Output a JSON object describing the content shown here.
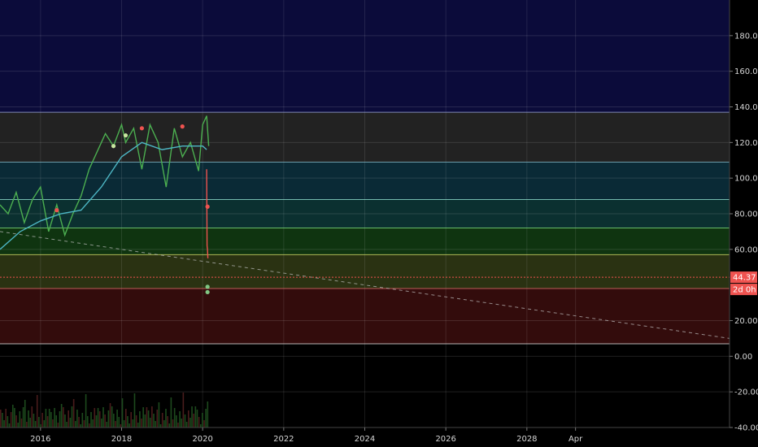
{
  "chart_data": {
    "type": "line",
    "xlim": [
      2015.0,
      2033.0
    ],
    "ylim": [
      -40,
      200
    ],
    "y_ticks": [
      {
        "value": 180,
        "label": "180.00"
      },
      {
        "value": 160,
        "label": "160.00"
      },
      {
        "value": 140,
        "label": "140.00"
      },
      {
        "value": 120,
        "label": "120.00"
      },
      {
        "value": 100,
        "label": "100.00"
      },
      {
        "value": 80,
        "label": "80.00"
      },
      {
        "value": 60,
        "label": "60.00"
      },
      {
        "value": 20,
        "label": "20.00"
      },
      {
        "value": 0,
        "label": "0.00"
      },
      {
        "value": -20,
        "label": "-20.00"
      },
      {
        "value": -40,
        "label": "-40.00"
      }
    ],
    "x_ticks": [
      {
        "value": 2016,
        "label": "2016"
      },
      {
        "value": 2018,
        "label": "2018"
      },
      {
        "value": 2020,
        "label": "2020"
      },
      {
        "value": 2022,
        "label": "2022"
      },
      {
        "value": 2024,
        "label": "2024"
      },
      {
        "value": 2026,
        "label": "2026"
      },
      {
        "value": 2028,
        "label": "2028"
      },
      {
        "value": 2029.2,
        "label": "Apr"
      }
    ],
    "bands": [
      {
        "from": 137,
        "to": 200,
        "color": "#0b0b3a"
      },
      {
        "from": 109,
        "to": 137,
        "color": "#222222"
      },
      {
        "from": 88,
        "to": 109,
        "color": "#0a2a36"
      },
      {
        "from": 72,
        "to": 88,
        "color": "#0b3030"
      },
      {
        "from": 57,
        "to": 72,
        "color": "#0f3410"
      },
      {
        "from": 38,
        "to": 57,
        "color": "#2a3212"
      },
      {
        "from": 7,
        "to": 38,
        "color": "#330c0c"
      }
    ],
    "band_lines": [
      {
        "value": 137,
        "color": "#9aa6d8"
      },
      {
        "value": 109,
        "color": "#7fb8c8"
      },
      {
        "value": 88,
        "color": "#8fe0d0"
      },
      {
        "value": 72,
        "color": "#7ee07a"
      },
      {
        "value": 57,
        "color": "#d4dc6a"
      },
      {
        "value": 38,
        "color": "#e06a6a"
      },
      {
        "value": 7,
        "color": "#e0e0e0"
      }
    ],
    "series": [
      {
        "color": "#4caf50",
        "x": [
          2015.0,
          2015.2,
          2015.4,
          2015.6,
          2015.8,
          2016.0,
          2016.2,
          2016.4,
          2016.6,
          2016.8,
          2017.0,
          2017.2,
          2017.4,
          2017.6,
          2017.8,
          2018.0,
          2018.1,
          2018.3,
          2018.5,
          2018.7,
          2018.9,
          2019.1,
          2019.3,
          2019.5,
          2019.7,
          2019.9,
          2020.0,
          2020.1,
          2020.15
        ],
        "y": [
          85,
          80,
          92,
          75,
          88,
          95,
          70,
          85,
          68,
          80,
          90,
          105,
          115,
          125,
          118,
          130,
          120,
          128,
          105,
          130,
          120,
          95,
          128,
          112,
          120,
          104,
          130,
          135,
          118
        ]
      },
      {
        "color": "#4db6c4",
        "x": [
          2015.0,
          2015.5,
          2016.0,
          2016.5,
          2017.0,
          2017.5,
          2018.0,
          2018.5,
          2019.0,
          2019.5,
          2020.0,
          2020.1
        ],
        "y": [
          60,
          70,
          76,
          80,
          82,
          95,
          112,
          120,
          116,
          118,
          118,
          116
        ]
      },
      {
        "color": "#ef5350",
        "x": [
          2020.1,
          2020.11,
          2020.12,
          2020.13
        ],
        "y": [
          105,
          62,
          60,
          55
        ]
      }
    ],
    "trendline": {
      "x": [
        2015.0,
        2033.0
      ],
      "y": [
        70,
        10
      ],
      "color": "#c0c0c0"
    },
    "current_price": {
      "value": 44.37,
      "label": "44.37",
      "countdown": "2d 0h",
      "color": "#ef5350"
    },
    "markers": [
      {
        "x": 2016.4,
        "y": 82,
        "color": "#ef5350"
      },
      {
        "x": 2018.5,
        "y": 128,
        "color": "#ef5350"
      },
      {
        "x": 2019.5,
        "y": 129,
        "color": "#ef5350"
      },
      {
        "x": 2020.12,
        "y": 84,
        "color": "#ef5350"
      },
      {
        "x": 2018.1,
        "y": 124,
        "color": "#c8e6a0"
      },
      {
        "x": 2017.8,
        "y": 118,
        "color": "#c8e6a0"
      },
      {
        "x": 2020.12,
        "y": 39,
        "color": "#81c784"
      },
      {
        "x": 2020.12,
        "y": 36,
        "color": "#81c784"
      }
    ]
  }
}
